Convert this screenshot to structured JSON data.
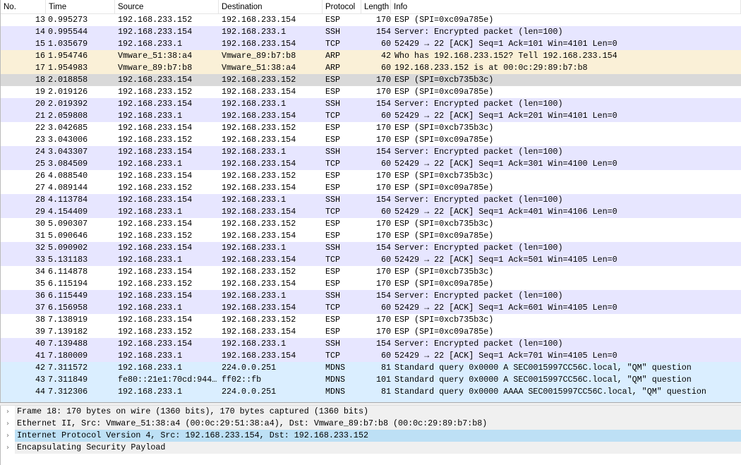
{
  "columns": [
    "No.",
    "Time",
    "Source",
    "Destination",
    "Protocol",
    "Length",
    "Info"
  ],
  "packets": [
    [
      "13",
      "0.995273",
      "192.168.233.152",
      "192.168.233.154",
      "ESP",
      "170",
      "ESP (SPI=0xc09a785e)",
      "esp"
    ],
    [
      "14",
      "0.995544",
      "192.168.233.154",
      "192.168.233.1",
      "SSH",
      "154",
      "Server: Encrypted packet (len=100)",
      "ssh"
    ],
    [
      "15",
      "1.035679",
      "192.168.233.1",
      "192.168.233.154",
      "TCP",
      "60",
      "52429 → 22 [ACK] Seq=1 Ack=101 Win=4101 Len=0",
      "tcp"
    ],
    [
      "16",
      "1.954746",
      "Vmware_51:38:a4",
      "Vmware_89:b7:b8",
      "ARP",
      "42",
      "Who has 192.168.233.152? Tell 192.168.233.154",
      "arp"
    ],
    [
      "17",
      "1.954983",
      "Vmware_89:b7:b8",
      "Vmware_51:38:a4",
      "ARP",
      "60",
      "192.168.233.152 is at 00:0c:29:89:b7:b8",
      "arp"
    ],
    [
      "18",
      "2.018858",
      "192.168.233.154",
      "192.168.233.152",
      "ESP",
      "170",
      "ESP (SPI=0xcb735b3c)",
      "sel"
    ],
    [
      "19",
      "2.019126",
      "192.168.233.152",
      "192.168.233.154",
      "ESP",
      "170",
      "ESP (SPI=0xc09a785e)",
      "esp"
    ],
    [
      "20",
      "2.019392",
      "192.168.233.154",
      "192.168.233.1",
      "SSH",
      "154",
      "Server: Encrypted packet (len=100)",
      "ssh"
    ],
    [
      "21",
      "2.059808",
      "192.168.233.1",
      "192.168.233.154",
      "TCP",
      "60",
      "52429 → 22 [ACK] Seq=1 Ack=201 Win=4101 Len=0",
      "tcp"
    ],
    [
      "22",
      "3.042685",
      "192.168.233.154",
      "192.168.233.152",
      "ESP",
      "170",
      "ESP (SPI=0xcb735b3c)",
      "esp"
    ],
    [
      "23",
      "3.043006",
      "192.168.233.152",
      "192.168.233.154",
      "ESP",
      "170",
      "ESP (SPI=0xc09a785e)",
      "esp"
    ],
    [
      "24",
      "3.043307",
      "192.168.233.154",
      "192.168.233.1",
      "SSH",
      "154",
      "Server: Encrypted packet (len=100)",
      "ssh"
    ],
    [
      "25",
      "3.084509",
      "192.168.233.1",
      "192.168.233.154",
      "TCP",
      "60",
      "52429 → 22 [ACK] Seq=1 Ack=301 Win=4100 Len=0",
      "tcp"
    ],
    [
      "26",
      "4.088540",
      "192.168.233.154",
      "192.168.233.152",
      "ESP",
      "170",
      "ESP (SPI=0xcb735b3c)",
      "esp"
    ],
    [
      "27",
      "4.089144",
      "192.168.233.152",
      "192.168.233.154",
      "ESP",
      "170",
      "ESP (SPI=0xc09a785e)",
      "esp"
    ],
    [
      "28",
      "4.113784",
      "192.168.233.154",
      "192.168.233.1",
      "SSH",
      "154",
      "Server: Encrypted packet (len=100)",
      "ssh"
    ],
    [
      "29",
      "4.154409",
      "192.168.233.1",
      "192.168.233.154",
      "TCP",
      "60",
      "52429 → 22 [ACK] Seq=1 Ack=401 Win=4106 Len=0",
      "tcp"
    ],
    [
      "30",
      "5.090307",
      "192.168.233.154",
      "192.168.233.152",
      "ESP",
      "170",
      "ESP (SPI=0xcb735b3c)",
      "esp"
    ],
    [
      "31",
      "5.090646",
      "192.168.233.152",
      "192.168.233.154",
      "ESP",
      "170",
      "ESP (SPI=0xc09a785e)",
      "esp"
    ],
    [
      "32",
      "5.090902",
      "192.168.233.154",
      "192.168.233.1",
      "SSH",
      "154",
      "Server: Encrypted packet (len=100)",
      "ssh"
    ],
    [
      "33",
      "5.131183",
      "192.168.233.1",
      "192.168.233.154",
      "TCP",
      "60",
      "52429 → 22 [ACK] Seq=1 Ack=501 Win=4105 Len=0",
      "tcp"
    ],
    [
      "34",
      "6.114878",
      "192.168.233.154",
      "192.168.233.152",
      "ESP",
      "170",
      "ESP (SPI=0xcb735b3c)",
      "esp"
    ],
    [
      "35",
      "6.115194",
      "192.168.233.152",
      "192.168.233.154",
      "ESP",
      "170",
      "ESP (SPI=0xc09a785e)",
      "esp"
    ],
    [
      "36",
      "6.115449",
      "192.168.233.154",
      "192.168.233.1",
      "SSH",
      "154",
      "Server: Encrypted packet (len=100)",
      "ssh"
    ],
    [
      "37",
      "6.156958",
      "192.168.233.1",
      "192.168.233.154",
      "TCP",
      "60",
      "52429 → 22 [ACK] Seq=1 Ack=601 Win=4105 Len=0",
      "tcp"
    ],
    [
      "38",
      "7.138919",
      "192.168.233.154",
      "192.168.233.152",
      "ESP",
      "170",
      "ESP (SPI=0xcb735b3c)",
      "esp"
    ],
    [
      "39",
      "7.139182",
      "192.168.233.152",
      "192.168.233.154",
      "ESP",
      "170",
      "ESP (SPI=0xc09a785e)",
      "esp"
    ],
    [
      "40",
      "7.139488",
      "192.168.233.154",
      "192.168.233.1",
      "SSH",
      "154",
      "Server: Encrypted packet (len=100)",
      "ssh"
    ],
    [
      "41",
      "7.180009",
      "192.168.233.1",
      "192.168.233.154",
      "TCP",
      "60",
      "52429 → 22 [ACK] Seq=1 Ack=701 Win=4105 Len=0",
      "tcp"
    ],
    [
      "42",
      "7.311572",
      "192.168.233.1",
      "224.0.0.251",
      "MDNS",
      "81",
      "Standard query 0x0000 A SEC0015997CC56C.local, \"QM\" question",
      "mdns"
    ],
    [
      "43",
      "7.311849",
      "fe80::21e1:70cd:944…",
      "ff02::fb",
      "MDNS",
      "101",
      "Standard query 0x0000 A SEC0015997CC56C.local, \"QM\" question",
      "mdns"
    ],
    [
      "44",
      "7.312306",
      "192.168.233.1",
      "224.0.0.251",
      "MDNS",
      "81",
      "Standard query 0x0000 AAAA SEC0015997CC56C.local, \"QM\" question",
      "mdns"
    ]
  ],
  "details": [
    {
      "text": "Frame 18: 170 bytes on wire (1360 bits), 170 bytes captured (1360 bits)",
      "selected": false
    },
    {
      "text": "Ethernet II, Src: Vmware_51:38:a4 (00:0c:29:51:38:a4), Dst: Vmware_89:b7:b8 (00:0c:29:89:b7:b8)",
      "selected": false
    },
    {
      "text": "Internet Protocol Version 4, Src: 192.168.233.154, Dst: 192.168.233.152",
      "selected": true
    },
    {
      "text": "Encapsulating Security Payload",
      "selected": false
    }
  ],
  "icons": {
    "expand": "chevron-right-icon"
  }
}
